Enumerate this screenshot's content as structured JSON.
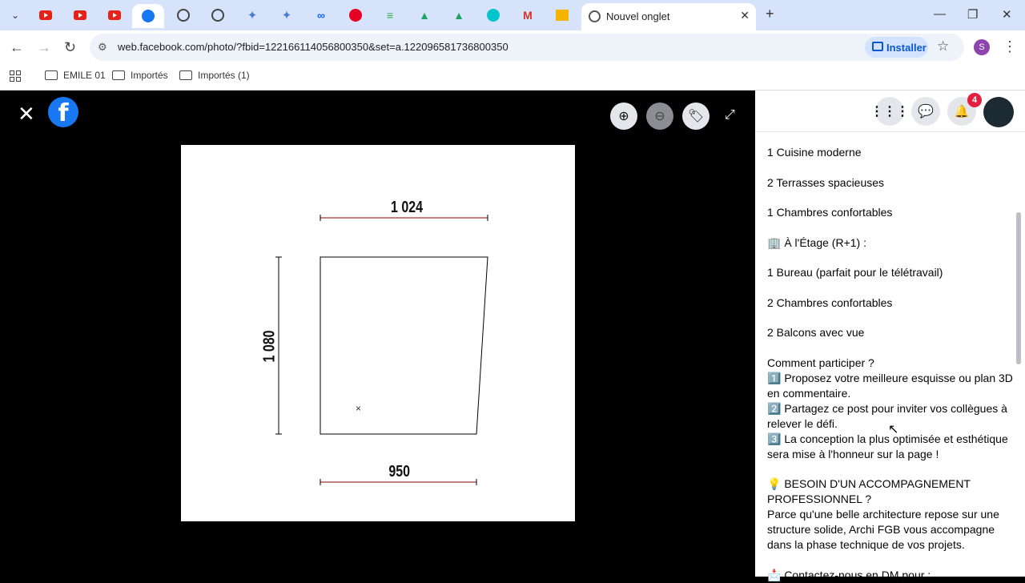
{
  "browser": {
    "tab_title": "Nouvel onglet",
    "url": "web.facebook.com/photo/?fbid=122166114056800350&set=a.122096581736800350",
    "install_label": "Installer",
    "profile_initial": "S",
    "bookmarks": [
      "EMILE 01",
      "Importés",
      "Importés (1)"
    ]
  },
  "viewer": {
    "dimensions": {
      "top": "1 024",
      "left": "1 080",
      "bottom": "950"
    }
  },
  "sidebar": {
    "notification_count": "4",
    "post_lines": [
      "1 Cuisine moderne",
      "",
      "2 Terrasses spacieuses",
      "",
      "1 Chambres confortables",
      "",
      "🏢 À l'Étage (R+1) :",
      "",
      "1 Bureau (parfait pour le télétravail)",
      "",
      "2 Chambres confortables",
      "",
      "2 Balcons avec vue",
      "",
      "Comment participer ?",
      "1️⃣ Proposez votre meilleure esquisse ou plan 3D en commentaire.",
      "2️⃣ Partagez ce post pour inviter vos collègues à relever le défi.",
      "3️⃣ La conception la plus optimisée et esthétique sera mise à l'honneur sur la page !",
      "",
      "💡 BESOIN D'UN ACCOMPAGNEMENT PROFESSIONNEL ?",
      "Parce qu'une belle architecture repose sur une structure solide, Archi FGB vous accompagne dans la phase technique de vos projets.",
      "",
      "📩 Contactez-nous en DM pour :"
    ]
  }
}
